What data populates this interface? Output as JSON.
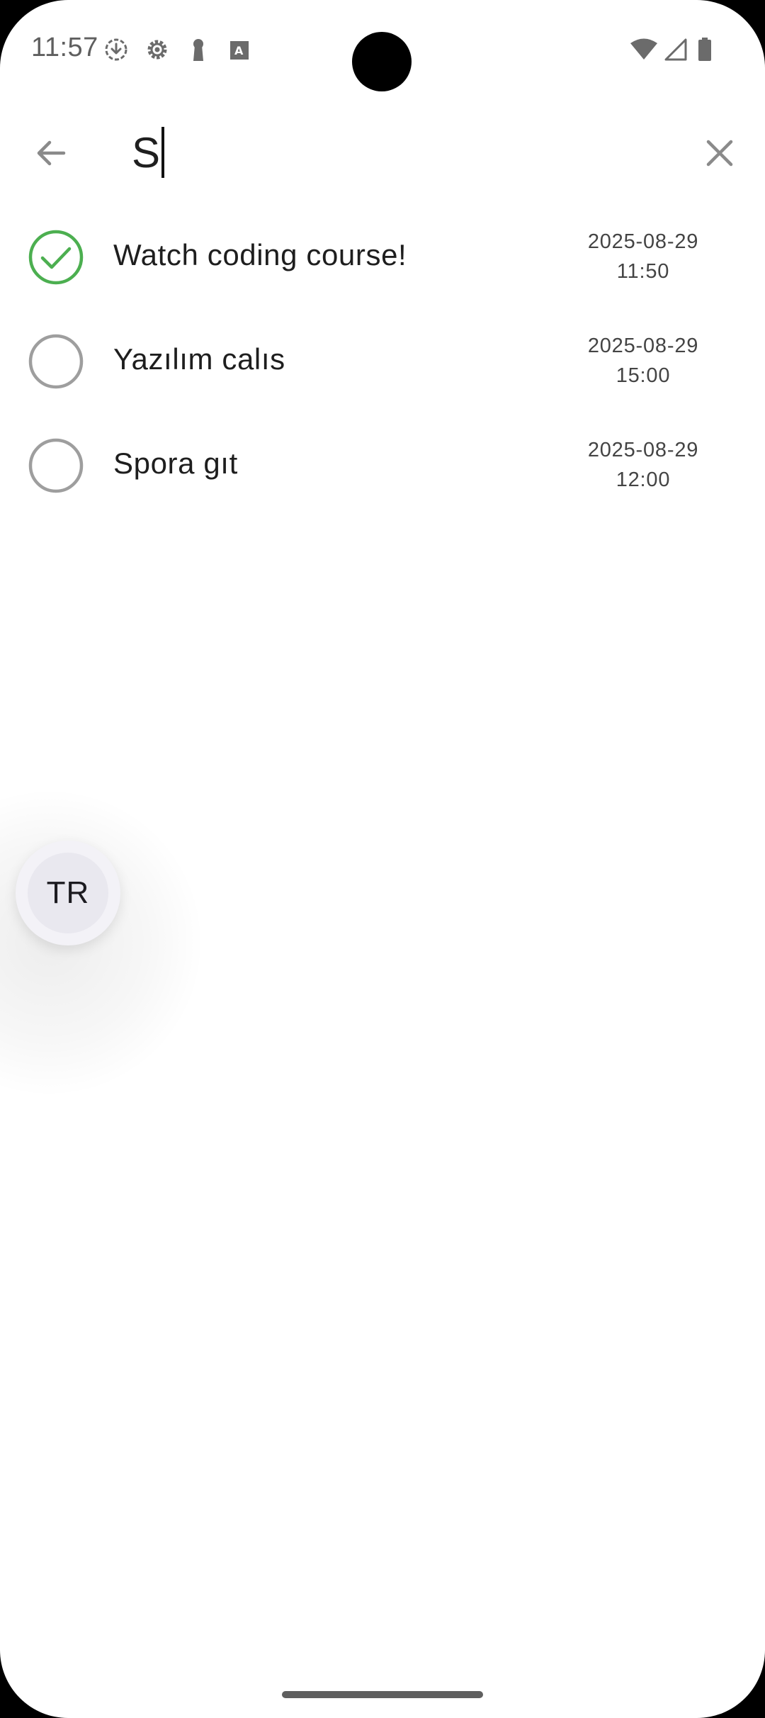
{
  "status_bar": {
    "time": "11:57",
    "left_icons": [
      "download-icon",
      "gear-icon",
      "keyhole-icon",
      "text-scan-icon"
    ],
    "right_icons": [
      "wifi-icon",
      "signal-icon",
      "battery-icon"
    ]
  },
  "search": {
    "query": "S",
    "back_icon": "arrow-left-icon",
    "clear_icon": "close-icon"
  },
  "tasks": [
    {
      "title": "Watch coding course!",
      "date": "2025-08-29",
      "time": "11:50",
      "done": true
    },
    {
      "title": "Yazılım calıs",
      "date": "2025-08-29",
      "time": "15:00",
      "done": false
    },
    {
      "title": "Spora gıt",
      "date": "2025-08-29",
      "time": "12:00",
      "done": false
    }
  ],
  "language_button": {
    "label": "TR"
  },
  "colors": {
    "done_green": "#4caf50",
    "undone_gray": "#9e9e9e",
    "icon_gray": "#8a8a8a",
    "text_dark": "#1e1e1e"
  }
}
